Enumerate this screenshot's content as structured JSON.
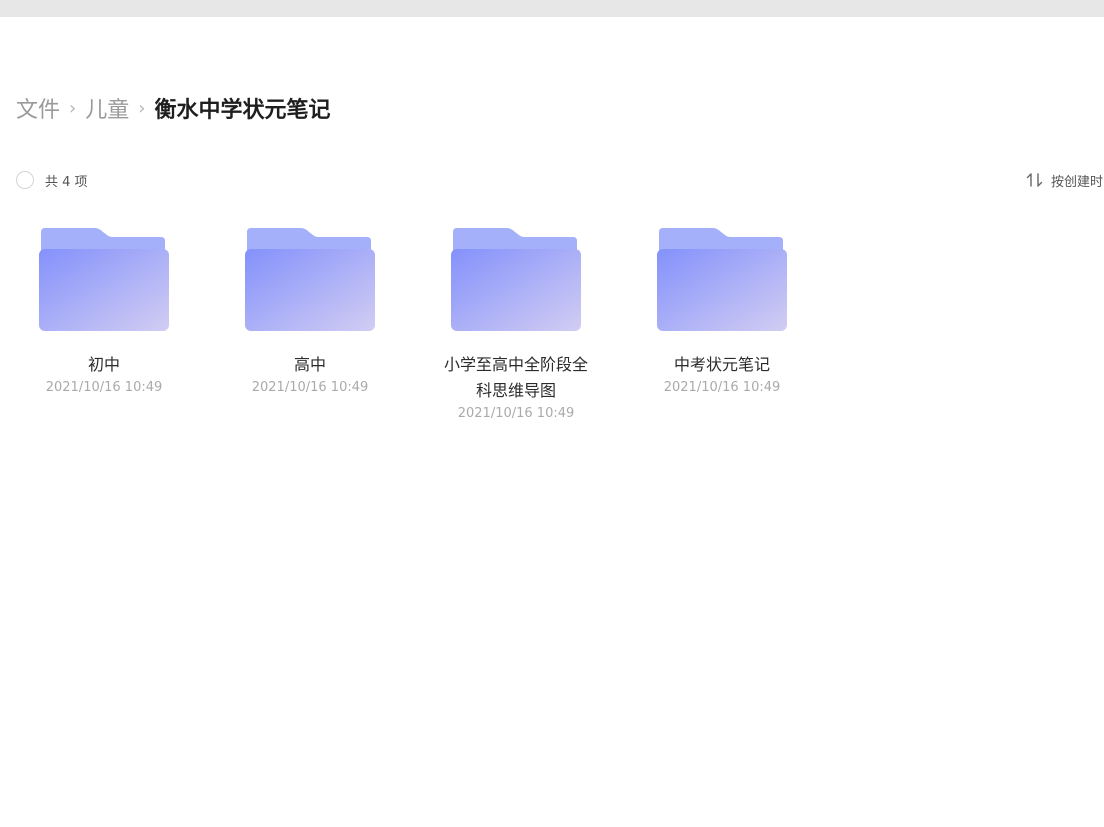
{
  "breadcrumb": {
    "items": [
      "文件",
      "儿童"
    ],
    "current": "衡水中学状元笔记",
    "separator": "›"
  },
  "toolbar": {
    "count_label": "共 4 项",
    "sort_label": "按创建时"
  },
  "folders": [
    {
      "name": "初中",
      "date": "2021/10/16 10:49"
    },
    {
      "name": "高中",
      "date": "2021/10/16 10:49"
    },
    {
      "name": "小学至高中全阶段全科思维导图",
      "date": "2021/10/16 10:49"
    },
    {
      "name": "中考状元笔记",
      "date": "2021/10/16 10:49"
    }
  ],
  "colors": {
    "folder_back": "#a5b0fb",
    "folder_front_start": "#8391fb",
    "folder_front_end": "#d2cdf3",
    "topbar": "#e7e7e7"
  }
}
